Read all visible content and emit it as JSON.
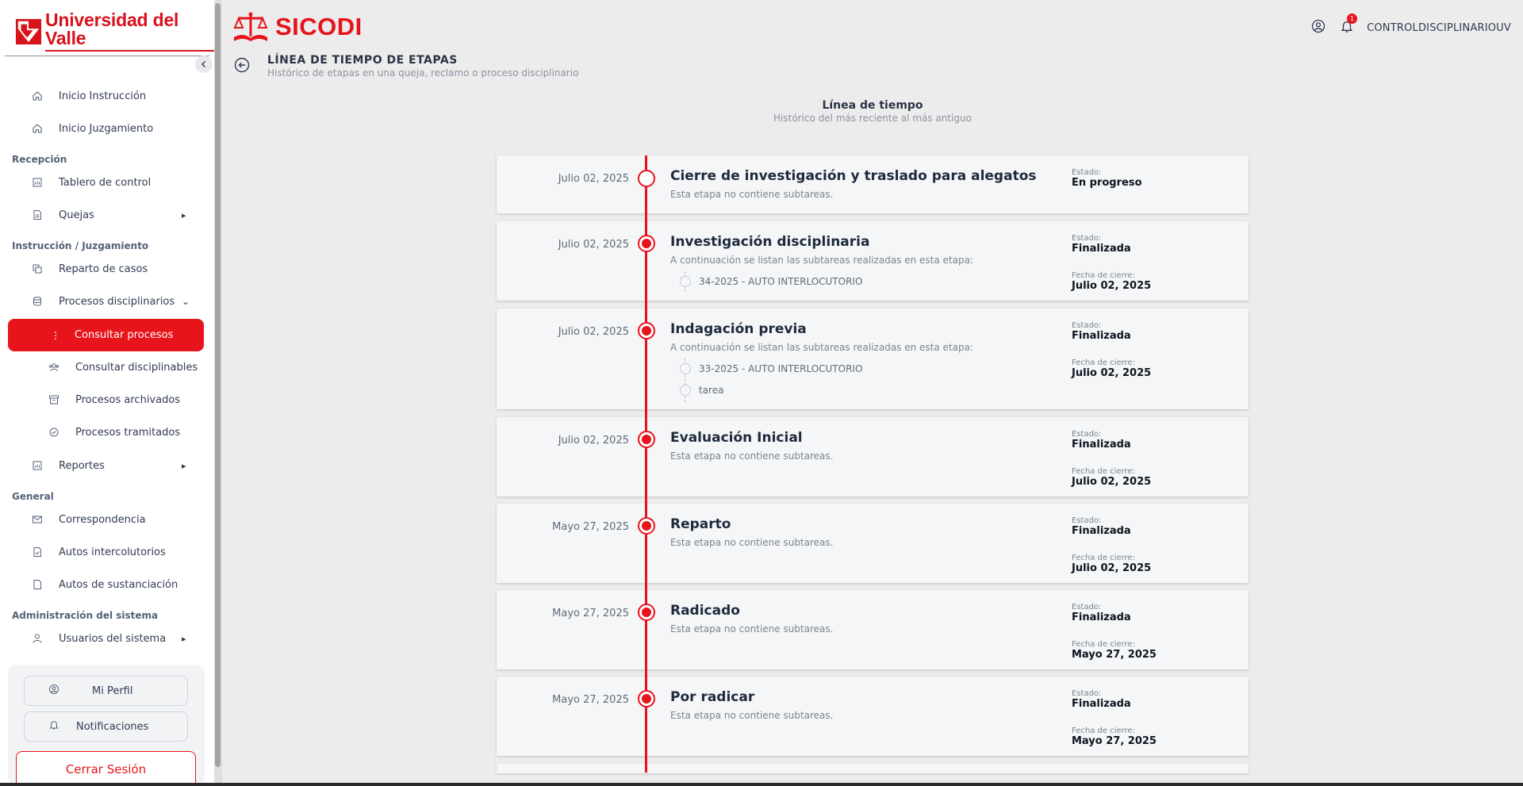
{
  "brand": {
    "university": "Universidad del Valle",
    "app": "SICODI"
  },
  "sidebar": {
    "items": [
      {
        "label": "Inicio Instrucción",
        "icon": "home-icon"
      },
      {
        "label": "Inicio Juzgamiento",
        "icon": "home-icon"
      },
      {
        "label": "Tablero de control",
        "icon": "chart-icon"
      },
      {
        "label": "Quejas",
        "icon": "document-icon"
      },
      {
        "label": "Reparto de casos",
        "icon": "copy-icon"
      },
      {
        "label": "Procesos disciplinarios",
        "icon": "database-icon"
      },
      {
        "label": "Consultar procesos",
        "icon": "list-icon"
      },
      {
        "label": "Consultar disciplinables",
        "icon": "users-icon"
      },
      {
        "label": "Procesos archivados",
        "icon": "archive-icon"
      },
      {
        "label": "Procesos tramitados",
        "icon": "check-circle-icon"
      },
      {
        "label": "Reportes",
        "icon": "chart-icon"
      },
      {
        "label": "Correspondencia",
        "icon": "mail-icon"
      },
      {
        "label": "Autos intercolutorios",
        "icon": "document-icon"
      },
      {
        "label": "Autos de sustanciación",
        "icon": "file-icon"
      },
      {
        "label": "Usuarios del sistema",
        "icon": "user-icon"
      }
    ],
    "sections": {
      "recepcion": "Recepción",
      "instruccion": "Instrucción / Juzgamiento",
      "general": "General",
      "administracion": "Administración del sistema"
    },
    "profile": "Mi Perfil",
    "notifications": "Notificaciones",
    "logout": "Cerrar Sesión"
  },
  "header": {
    "username": "CONTROLDISCIPLINARIOUV",
    "notification_count": "1",
    "page_title": "LÍNEA DE TIEMPO DE ETAPAS",
    "page_subtitle": "Histórico de etapas en una queja, reclamo o proceso disciplinario"
  },
  "timeline": {
    "title": "Línea de tiempo",
    "subtitle": "Histórico del más reciente al más antiguo",
    "estado_label": "Estado:",
    "cierre_label": "Fecha de cierre:",
    "stages": [
      {
        "date": "Julio 02, 2025",
        "title": "Cierre de investigación y traslado para alegatos",
        "desc": "Esta etapa no contiene subtareas.",
        "status": "En progreso",
        "close_date": ""
      },
      {
        "date": "Julio 02, 2025",
        "title": "Investigación disciplinaria",
        "desc": "A continuación se listan las subtareas realizadas en esta etapa:",
        "subtasks": [
          "34-2025 - AUTO INTERLOCUTORIO"
        ],
        "status": "Finalizada",
        "close_date": "Julio 02, 2025"
      },
      {
        "date": "Julio 02, 2025",
        "title": "Indagación previa",
        "desc": "A continuación se listan las subtareas realizadas en esta etapa:",
        "subtasks": [
          "33-2025 - AUTO INTERLOCUTORIO",
          "tarea"
        ],
        "status": "Finalizada",
        "close_date": "Julio 02, 2025"
      },
      {
        "date": "Julio 02, 2025",
        "title": "Evaluación Inicial",
        "desc": "Esta etapa no contiene subtareas.",
        "status": "Finalizada",
        "close_date": "Julio 02, 2025"
      },
      {
        "date": "Mayo 27, 2025",
        "title": "Reparto",
        "desc": "Esta etapa no contiene subtareas.",
        "status": "Finalizada",
        "close_date": "Julio 02, 2025"
      },
      {
        "date": "Mayo 27, 2025",
        "title": "Radicado",
        "desc": "Esta etapa no contiene subtareas.",
        "status": "Finalizada",
        "close_date": "Mayo 27, 2025"
      },
      {
        "date": "Mayo 27, 2025",
        "title": "Por radicar",
        "desc": "Esta etapa no contiene subtareas.",
        "status": "Finalizada",
        "close_date": "Mayo 27, 2025"
      }
    ]
  },
  "colors": {
    "accent": "#e8141c",
    "brand": "#d8121b"
  }
}
